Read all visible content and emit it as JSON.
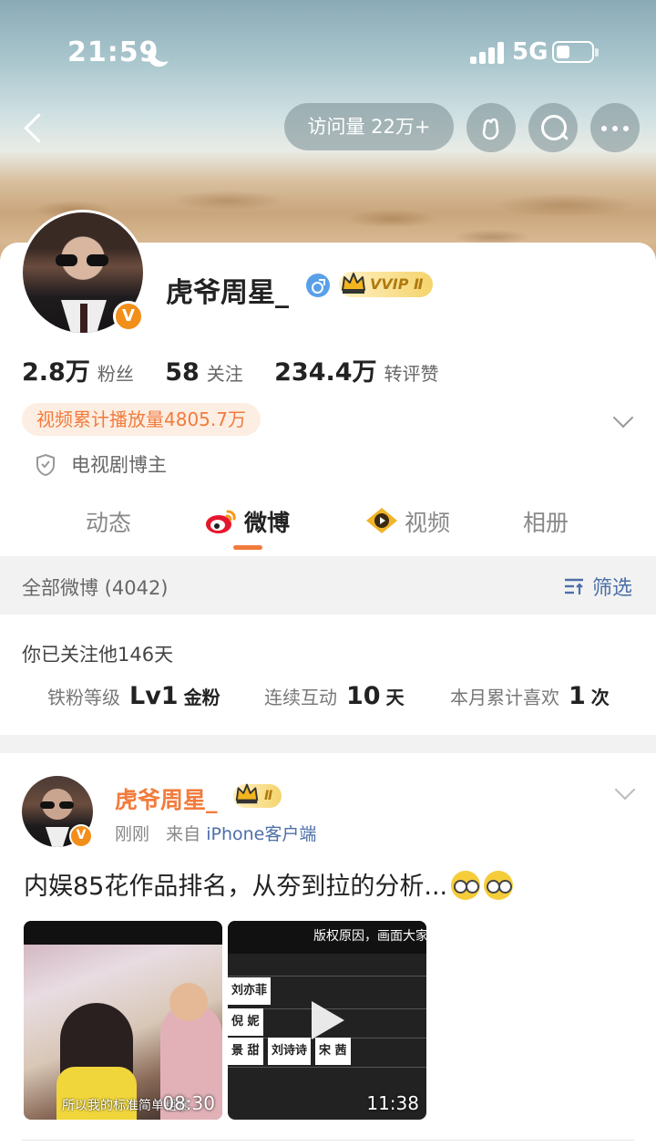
{
  "status_bar": {
    "time": "21:59",
    "network": "5G",
    "icons": [
      "moon-icon",
      "signal-icon",
      "battery-icon"
    ]
  },
  "header": {
    "visits": "访问量 22万+",
    "icons": [
      "back-icon",
      "gift-icon",
      "search-icon",
      "more-icon"
    ]
  },
  "profile": {
    "name": "虎爷周星_",
    "verified_badge": "V",
    "vip_label": "VVIP Ⅱ",
    "stats": [
      {
        "value": "2.8万",
        "label": "粉丝"
      },
      {
        "value": "58",
        "label": "关注"
      },
      {
        "value": "234.4万",
        "label": "转评赞"
      }
    ],
    "video_plays": "视频累计播放量4805.7万",
    "role": "电视剧博主"
  },
  "tabs": [
    "动态",
    "微博",
    "视频",
    "相册"
  ],
  "active_tab": "微博",
  "filter": {
    "count_label": "全部微博 (4042)",
    "filter_label": "筛选"
  },
  "fan": {
    "days_label": "你已关注他146天",
    "stats": [
      {
        "label": "铁粉等级",
        "value": "Lv1",
        "unit": "金粉"
      },
      {
        "label": "连续互动",
        "value": "10",
        "unit": "天"
      },
      {
        "label": "本月累计喜欢",
        "value": "1",
        "unit": "次"
      }
    ]
  },
  "post": {
    "author": "虎爷周星_",
    "vip_label": "Ⅱ",
    "time": "刚刚",
    "source_prefix": "来自",
    "source": "iPhone客户端",
    "text": "内娱85花作品排名，从夯到拉的分析...",
    "videos": [
      {
        "duration": "08:30",
        "subtitle": "所以我的标准简单粗暴"
      },
      {
        "duration": "11:38",
        "top_text": "版权原因，画面大家自",
        "names": [
          "刘亦菲",
          "倪 妮",
          "景 甜",
          "刘诗诗",
          "宋 茜"
        ]
      }
    ]
  },
  "colors": {
    "accent": "#f27b3c",
    "link": "#4c6fa8",
    "vip_gold": "#f5d46c"
  }
}
